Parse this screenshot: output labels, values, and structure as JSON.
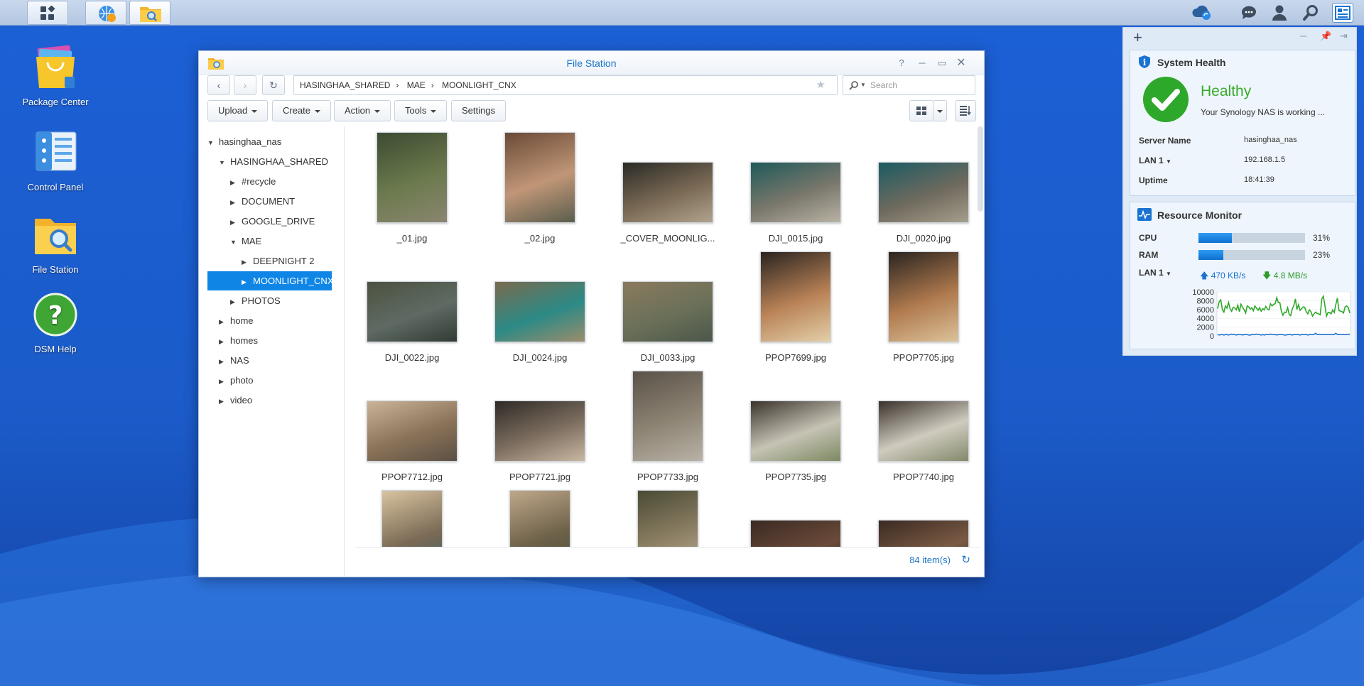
{
  "colors": {
    "accent": "#1b74c5",
    "selection": "#0f86e6",
    "healthy": "#3bab2b",
    "desktop": "#1f5fce"
  },
  "taskbar": {
    "left_items": [
      "main-menu-icon",
      "dsm-cloud-icon",
      "file-station-icon"
    ],
    "right_items": [
      "cloud-sync-icon",
      "chat-icon",
      "user-icon",
      "search-icon",
      "widgets-icon"
    ]
  },
  "desktop": {
    "icons": [
      {
        "label": "Package Center",
        "icon": "package-center-icon"
      },
      {
        "label": "Control Panel",
        "icon": "control-panel-icon"
      },
      {
        "label": "File Station",
        "icon": "file-station-icon"
      },
      {
        "label": "DSM Help",
        "icon": "help-icon"
      }
    ]
  },
  "file_station": {
    "title": "File Station",
    "path": [
      "HASINGHAA_SHARED",
      "MAE",
      "MOONLIGHT_CNX"
    ],
    "search_placeholder": "Search",
    "toolbar": {
      "upload": "Upload",
      "create": "Create",
      "action": "Action",
      "tools": "Tools",
      "settings": "Settings"
    },
    "tree": [
      {
        "label": "hasinghaa_nas",
        "level": 0,
        "expanded": true
      },
      {
        "label": "HASINGHAA_SHARED",
        "level": 1,
        "expanded": true
      },
      {
        "label": "#recycle",
        "level": 2,
        "expanded": false
      },
      {
        "label": "DOCUMENT",
        "level": 2,
        "expanded": false
      },
      {
        "label": "GOOGLE_DRIVE",
        "level": 2,
        "expanded": false
      },
      {
        "label": "MAE",
        "level": 2,
        "expanded": true
      },
      {
        "label": "DEEPNIGHT 2",
        "level": 3,
        "expanded": false
      },
      {
        "label": "MOONLIGHT_CNX",
        "level": 3,
        "expanded": false,
        "selected": true
      },
      {
        "label": "PHOTOS",
        "level": 2,
        "expanded": false
      },
      {
        "label": "home",
        "level": 1,
        "expanded": false
      },
      {
        "label": "homes",
        "level": 1,
        "expanded": false
      },
      {
        "label": "NAS",
        "level": 1,
        "expanded": false
      },
      {
        "label": "photo",
        "level": 1,
        "expanded": false
      },
      {
        "label": "video",
        "level": 1,
        "expanded": false
      }
    ],
    "files": [
      {
        "name": "_01.jpg",
        "orient": "portrait",
        "palette": [
          "#3d4a32",
          "#6b7a4d",
          "#8a8570"
        ]
      },
      {
        "name": "_02.jpg",
        "orient": "portrait",
        "palette": [
          "#6a4a36",
          "#c09677",
          "#5a5d4c"
        ]
      },
      {
        "name": "_COVER_MOONLIG...",
        "orient": "landscape",
        "palette": [
          "#2a2a26",
          "#7a6a55",
          "#b0a38d"
        ]
      },
      {
        "name": "DJI_0015.jpg",
        "orient": "landscape",
        "palette": [
          "#1f5a58",
          "#7a776c",
          "#b9b3a4"
        ]
      },
      {
        "name": "DJI_0020.jpg",
        "orient": "landscape",
        "palette": [
          "#1c5b62",
          "#6f6a5e",
          "#a69e8c"
        ]
      },
      {
        "name": "DJI_0022.jpg",
        "orient": "landscape",
        "palette": [
          "#4c5240",
          "#5e6a63",
          "#2f3b33"
        ]
      },
      {
        "name": "DJI_0024.jpg",
        "orient": "landscape",
        "palette": [
          "#7a6a4e",
          "#2c8a86",
          "#9c8c6c"
        ]
      },
      {
        "name": "DJI_0033.jpg",
        "orient": "landscape",
        "palette": [
          "#8a7a5e",
          "#6a7058",
          "#4c564a"
        ]
      },
      {
        "name": "PPOP7699.jpg",
        "orient": "portrait",
        "palette": [
          "#2a2420",
          "#b98256",
          "#e3cfa9"
        ]
      },
      {
        "name": "PPOP7705.jpg",
        "orient": "portrait",
        "palette": [
          "#2a2420",
          "#b07a4e",
          "#dcc29a"
        ]
      },
      {
        "name": "PPOP7712.jpg",
        "orient": "landscape",
        "palette": [
          "#c9b49a",
          "#8a7258",
          "#5c5044"
        ]
      },
      {
        "name": "PPOP7721.jpg",
        "orient": "landscape",
        "palette": [
          "#2e2a27",
          "#7e6f60",
          "#c8b7a2"
        ]
      },
      {
        "name": "PPOP7733.jpg",
        "orient": "portrait",
        "palette": [
          "#5a5248",
          "#8d8474",
          "#b9b2a5"
        ]
      },
      {
        "name": "PPOP7735.jpg",
        "orient": "landscape",
        "palette": [
          "#3b342c",
          "#c6c3b5",
          "#7d8a62"
        ]
      },
      {
        "name": "PPOP7740.jpg",
        "orient": "landscape",
        "palette": [
          "#3a322b",
          "#cfcbbf",
          "#83896a"
        ]
      },
      {
        "name": "",
        "orient": "portrait",
        "palette": [
          "#d9c4a0",
          "#7a6a55",
          "#3b5c66"
        ]
      },
      {
        "name": "",
        "orient": "portrait",
        "palette": [
          "#bfa88a",
          "#6c6048",
          "#4b5038"
        ]
      },
      {
        "name": "",
        "orient": "portrait",
        "palette": [
          "#4a4a34",
          "#8f8266",
          "#c6b9a0"
        ]
      },
      {
        "name": "",
        "orient": "landscape",
        "palette": [
          "#3a2a22",
          "#6a4a3a",
          "#2a2a28"
        ]
      },
      {
        "name": "",
        "orient": "landscape",
        "palette": [
          "#3a2a22",
          "#7a5a44",
          "#2e2a28"
        ]
      }
    ],
    "status": {
      "item_count": "84 item(s)"
    }
  },
  "system_health": {
    "title": "System Health",
    "status": "Healthy",
    "message": "Your Synology NAS is working ...",
    "server_name_label": "Server Name",
    "server_name": "hasinghaa_nas",
    "lan_label": "LAN 1",
    "ip": "192.168.1.5",
    "uptime_label": "Uptime",
    "uptime": "18:41:39"
  },
  "resource_monitor": {
    "title": "Resource Monitor",
    "cpu_label": "CPU",
    "cpu_value": "31%",
    "cpu_fraction": 0.31,
    "ram_label": "RAM",
    "ram_value": "23%",
    "ram_fraction": 0.23,
    "lan_label": "LAN 1",
    "upload": "470 KB/s",
    "download": "4.8 MB/s",
    "chart_data": {
      "type": "line",
      "y_ticks": [
        "10000",
        "8000",
        "6000",
        "4000",
        "2000",
        "0"
      ],
      "ylim": [
        0,
        10000
      ],
      "series": [
        {
          "values": [
            6200,
            7800,
            8200,
            6000,
            5400,
            6800,
            6300,
            7600,
            6200,
            5600,
            6500,
            6300,
            5900,
            7000,
            5500,
            7200,
            6500,
            6000,
            5200,
            6800,
            6600,
            6100,
            6400,
            5700,
            6800,
            6300,
            5800,
            6400,
            5600,
            6200,
            5900,
            6700,
            6100,
            5900,
            7300,
            6800,
            7200,
            7300,
            8700,
            7600,
            7600,
            5600,
            4700,
            5400,
            5300,
            6400,
            4900,
            4600,
            6100,
            6900,
            8400,
            6000,
            7100,
            5800,
            6200,
            6600,
            6500,
            5500,
            5000,
            5900,
            5500,
            4500,
            5000,
            5400,
            5100,
            5000,
            4800,
            8400,
            9000,
            6900,
            4500,
            5300,
            5300,
            5000,
            5900,
            5300,
            7100,
            8600,
            5800,
            5600,
            5500,
            5200,
            6600,
            6800,
            6500,
            5200
          ]
        },
        {
          "values": [
            300,
            200,
            300,
            300,
            200,
            300,
            300,
            200,
            300,
            400,
            300,
            300,
            200,
            300,
            300,
            300,
            200,
            300,
            300,
            300,
            200,
            200,
            300,
            300,
            300,
            400,
            300,
            300,
            200,
            300,
            200,
            300,
            300,
            300,
            400,
            300,
            300,
            300,
            200,
            300,
            300,
            300,
            300,
            200,
            200,
            300,
            300,
            300,
            200,
            300,
            300,
            300,
            300,
            200,
            300,
            300,
            300,
            300,
            200,
            300,
            300,
            300,
            300,
            600,
            300,
            300,
            300,
            300,
            300,
            300,
            300,
            300,
            300,
            300,
            300,
            300,
            600,
            300,
            300,
            300,
            300,
            300,
            300,
            300,
            400,
            300
          ]
        }
      ]
    }
  },
  "widget_panel": {
    "add_label": "+"
  }
}
